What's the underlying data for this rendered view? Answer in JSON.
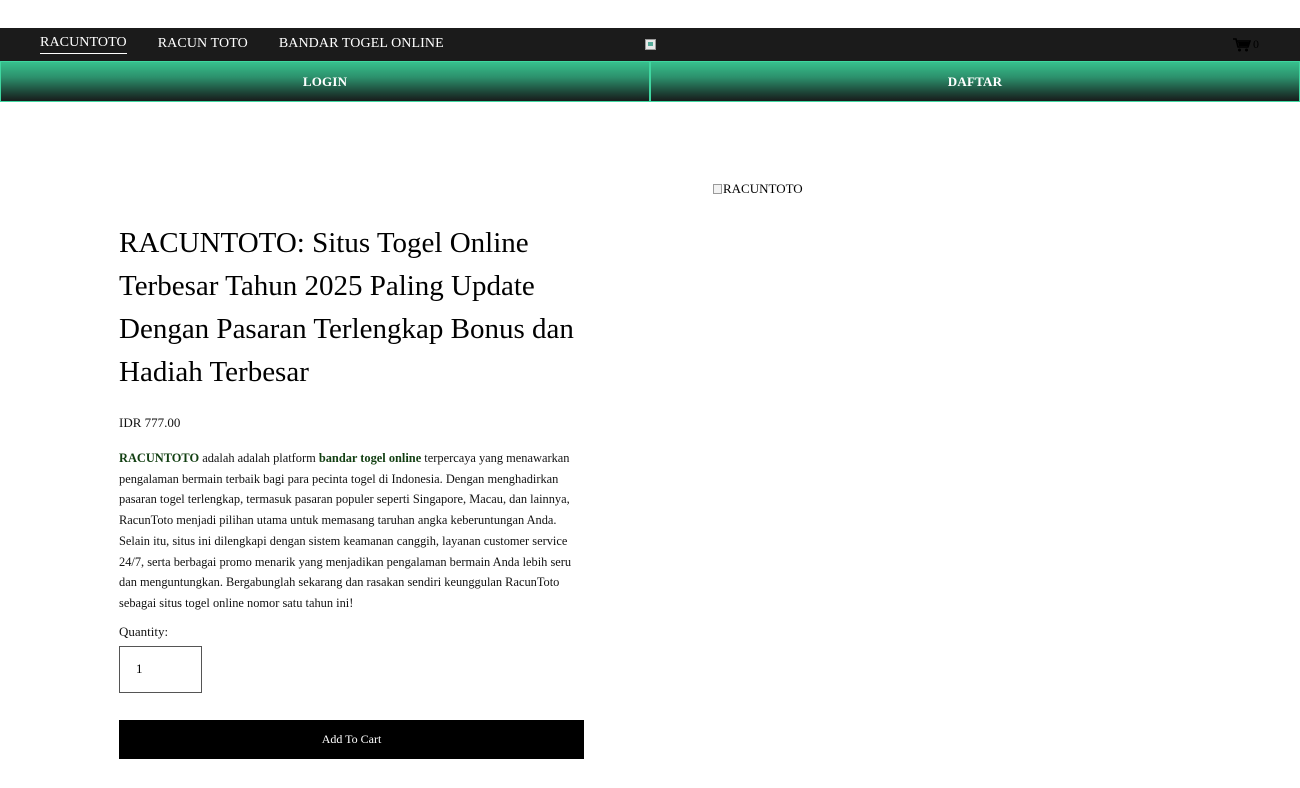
{
  "nav": {
    "items": [
      {
        "label": "RACUNTOTO",
        "active": true
      },
      {
        "label": "RACUN TOTO",
        "active": false
      },
      {
        "label": "BANDAR TOGEL ONLINE",
        "active": false
      }
    ]
  },
  "cart": {
    "count": "0",
    "icon": "cart-icon"
  },
  "buttons": {
    "login": "LOGIN",
    "daftar": "DAFTAR"
  },
  "hero_image": {
    "alt": "RACUNTOTO"
  },
  "product": {
    "title": "RACUNTOTO: Situs Togel Online Terbesar Tahun 2025 Paling Update Dengan Pasaran Terlengkap Bonus dan Hadiah Terbesar",
    "price": "IDR 777.00",
    "desc_brand": "RACUNTOTO",
    "desc_part1": " adalah adalah platform ",
    "desc_link": "bandar togel online",
    "desc_part2": " terpercaya yang menawarkan pengalaman bermain terbaik bagi para pecinta togel di Indonesia. Dengan menghadirkan pasaran togel terlengkap, termasuk pasaran populer seperti Singapore, Macau, dan lainnya, RacunToto menjadi pilihan utama untuk memasang taruhan angka keberuntungan Anda. Selain itu, situs ini dilengkapi dengan sistem keamanan canggih, layanan customer service 24/7, serta berbagai promo menarik yang menjadikan pengalaman bermain Anda lebih seru dan menguntungkan. Bergabunglah sekarang dan rasakan sendiri keunggulan RacunToto sebagai situs togel online nomor satu tahun ini!",
    "quantity_label": "Quantity:",
    "quantity_value": "1",
    "add_to_cart": "Add To Cart"
  },
  "colors": {
    "topbar": "#1b1b1b",
    "button_green": "#37c08d",
    "link_green": "#123f12"
  }
}
